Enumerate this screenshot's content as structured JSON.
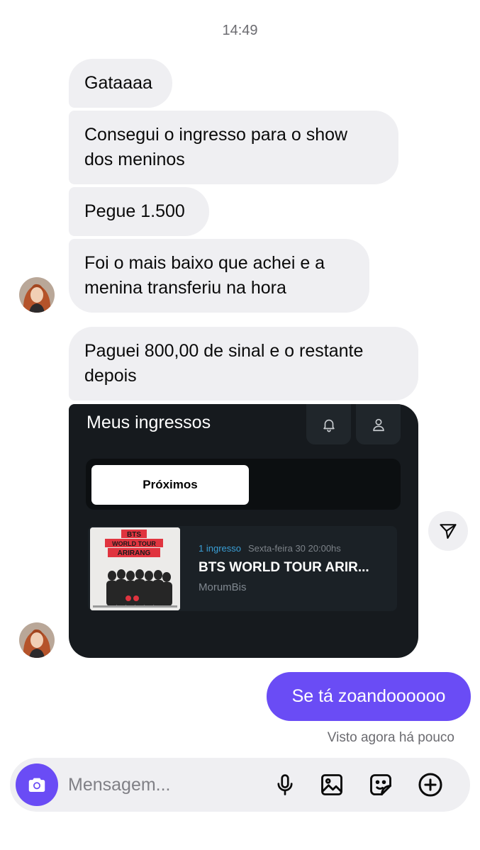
{
  "chat": {
    "timestamp": "14:49",
    "received": [
      "Gataaaa",
      "Consegui o ingresso para o show\ndos meninos",
      "Pegue 1.500",
      "Foi o mais baixo que achei e a\nmenina transferiu na hora",
      "Paguei 800,00 de sinal e o restante\ndepois"
    ],
    "sent": [
      "Se tá zoandoooooo"
    ],
    "seen_status": "Visto agora há pouco"
  },
  "shared_screenshot": {
    "title": "Meus ingressos",
    "tab_active": "Próximos",
    "ticket": {
      "count": "1 ingresso",
      "date": "Sexta-feira 30 20:00hs",
      "name": "BTS WORLD TOUR ARIR...",
      "venue": "MorumBis",
      "poster_text": [
        "BTS",
        "WORLD TOUR",
        "ARIRANG"
      ]
    },
    "icons": [
      "bell-icon",
      "user-icon"
    ]
  },
  "composer": {
    "placeholder": "Mensagem...",
    "icons": [
      "camera-icon",
      "microphone-icon",
      "image-icon",
      "sticker-icon",
      "plus-circle-icon"
    ]
  },
  "colors": {
    "accent": "#6a4cf5",
    "bubble_received": "#efeff2",
    "card_bg": "#161a1e",
    "poster_red": "#e0343f"
  }
}
